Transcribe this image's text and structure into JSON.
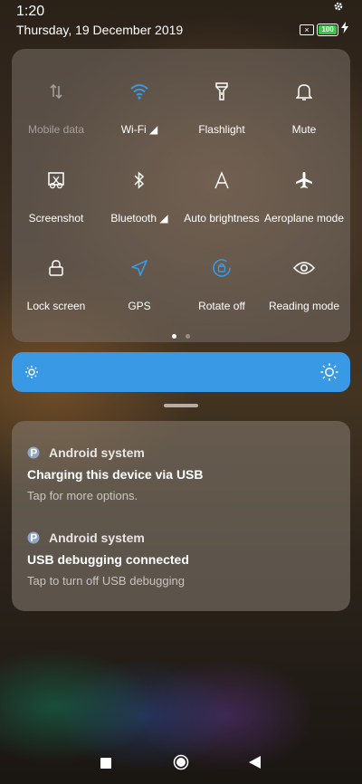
{
  "status_bar": {
    "time": "1:20",
    "date": "Thursday, 19 December 2019",
    "battery_level": "100",
    "icons": [
      "settings-icon",
      "no-sim-icon",
      "battery-icon",
      "charging-bolt-icon"
    ]
  },
  "quick_settings": {
    "tiles": [
      {
        "label": "Mobile data",
        "icon": "mobile-data-icon",
        "state": "off"
      },
      {
        "label": "Wi-Fi ◢",
        "icon": "wifi-icon",
        "state": "on"
      },
      {
        "label": "Flashlight",
        "icon": "flashlight-icon",
        "state": "idle"
      },
      {
        "label": "Mute",
        "icon": "bell-icon",
        "state": "idle"
      },
      {
        "label": "Screenshot",
        "icon": "screenshot-icon",
        "state": "idle"
      },
      {
        "label": "Bluetooth ◢",
        "icon": "bluetooth-icon",
        "state": "idle"
      },
      {
        "label": "Auto brightness",
        "icon": "auto-brightness-icon",
        "state": "idle"
      },
      {
        "label": "Aeroplane mode",
        "icon": "aeroplane-icon",
        "state": "idle"
      },
      {
        "label": "Lock screen",
        "icon": "lock-icon",
        "state": "idle"
      },
      {
        "label": "GPS",
        "icon": "gps-icon",
        "state": "on"
      },
      {
        "label": "Rotate off",
        "icon": "rotate-icon",
        "state": "on"
      },
      {
        "label": "Reading mode",
        "icon": "eye-icon",
        "state": "idle"
      }
    ],
    "page_count": 2,
    "current_page": 1
  },
  "brightness": {
    "level": 1.0,
    "color": "#3a99e4"
  },
  "notifications": [
    {
      "app": "Android system",
      "title": "Charging this device via USB",
      "text": "Tap for more options."
    },
    {
      "app": "Android system",
      "title": "USB debugging connected",
      "text": "Tap to turn off USB debugging"
    }
  ],
  "nav_bar": {
    "buttons": [
      "recents-icon",
      "home-icon",
      "back-icon"
    ]
  },
  "colors": {
    "accent": "#3a99e4",
    "battery": "#3cc44a"
  }
}
